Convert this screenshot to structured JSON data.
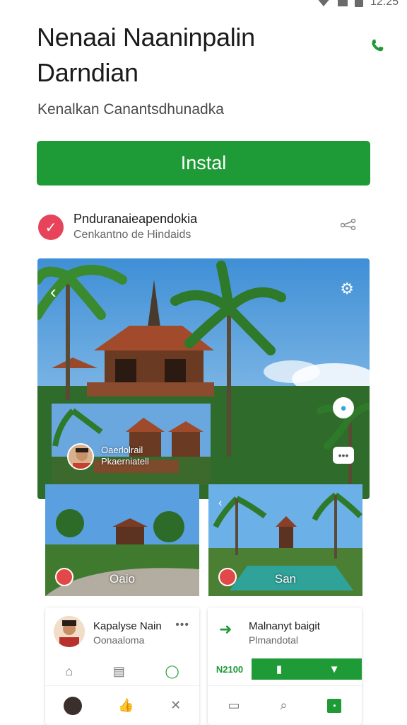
{
  "status_bar": {
    "time": "12:25"
  },
  "header": {
    "title": "Nenaai Naaninpalin Darndian",
    "subtitle": "Kenalkan Canantsdhunadka"
  },
  "install_button": {
    "label": "Instal"
  },
  "feature": {
    "title": "Pnduranaieapendokia",
    "subtitle": "Cenkantno de Hindaids"
  },
  "gallery": {
    "inset_title": "Oaerlolrail",
    "inset_subtitle": "Pkaerniatell"
  },
  "thumbnails": [
    {
      "label": "Oaio"
    },
    {
      "label": "San"
    }
  ],
  "cards": [
    {
      "title": "Kapalyse Nain",
      "subtitle": "Oonaaloma"
    },
    {
      "title": "Malnanyt baigit",
      "subtitle": "Plmandotal",
      "count": "N2100"
    }
  ],
  "colors": {
    "brand_green": "#1e9a37",
    "alert_red": "#e7435a",
    "map_blue": "#2da8df"
  },
  "icons": {
    "header": [
      "phone-icon"
    ],
    "feature": [
      "check-icon",
      "share-icon"
    ],
    "gallery": [
      "back-arrow-icon",
      "settings-icon",
      "location-pin-icon",
      "chat-bubble-icon"
    ],
    "card1": [
      "home-icon",
      "bookmark-icon",
      "search-icon",
      "thumb-up-icon",
      "close-icon"
    ],
    "card2": [
      "arrow-right-icon",
      "bookmark-icon",
      "chevron-down-icon",
      "tablet-icon",
      "search-icon",
      "square-icon"
    ]
  }
}
